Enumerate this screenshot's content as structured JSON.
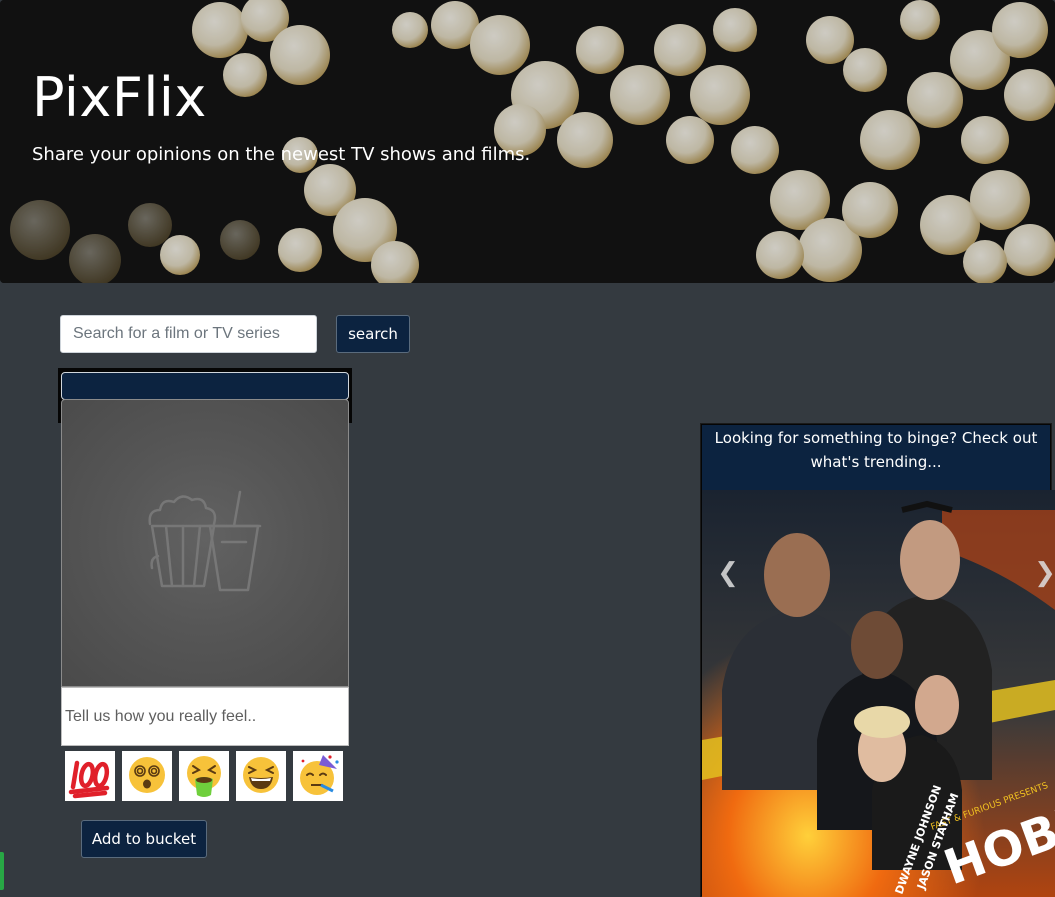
{
  "hero": {
    "title": "PixFlix",
    "subtitle": "Share your opinions on the newest TV shows and films."
  },
  "search": {
    "placeholder": "Search for a film or TV series",
    "button_label": "search"
  },
  "card": {
    "poster_icon": "popcorn-and-drink-placeholder-icon",
    "feelings_placeholder": "Tell us how you really feel..",
    "reactions": [
      {
        "icon": "hundred-points-emoji-icon"
      },
      {
        "icon": "dizzy-face-emoji-icon"
      },
      {
        "icon": "vomiting-face-emoji-icon"
      },
      {
        "icon": "laughing-face-emoji-icon"
      },
      {
        "icon": "partying-face-emoji-icon"
      }
    ],
    "add_button_label": "Add to bucket"
  },
  "trending": {
    "heading": "Looking for something to binge? Check out what's trending...",
    "slide": {
      "poster_title": "HOBBS & SHAW",
      "poster_kicker": "FAST & FURIOUS PRESENTS",
      "actor_1": "DWAYNE JOHNSON",
      "actor_2": "JASON STATHAM"
    },
    "prev_icon": "chevron-left-icon",
    "next_icon": "chevron-right-icon"
  },
  "colors": {
    "background": "#343a40",
    "navy": "#0c2340",
    "accent_green": "#28a745"
  }
}
